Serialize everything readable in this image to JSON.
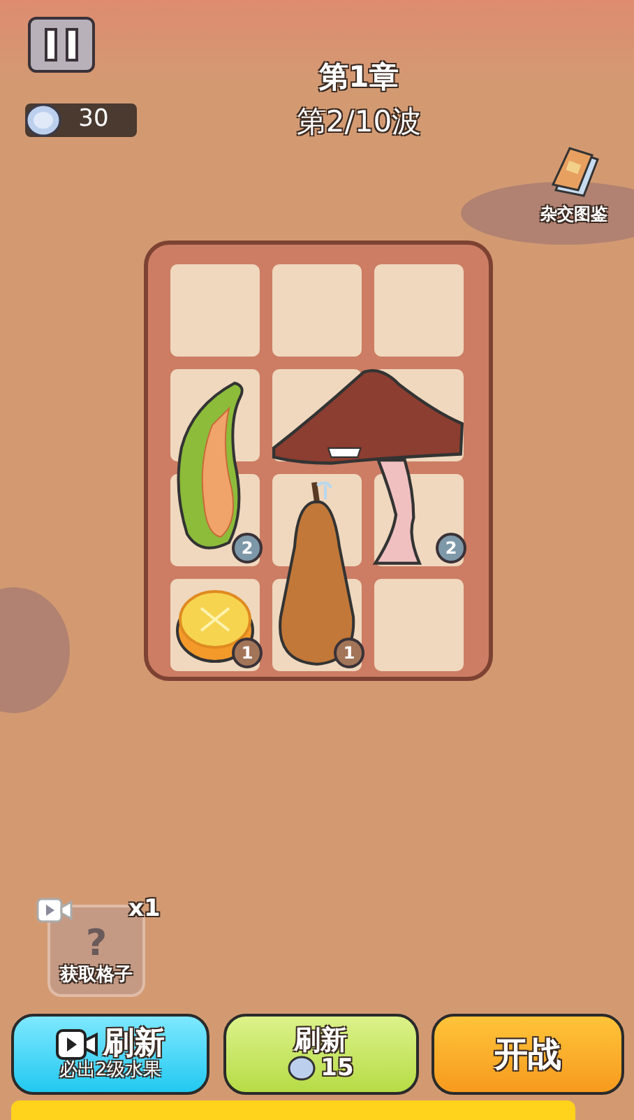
{
  "header": {
    "chapter": "第1章",
    "wave": "第2/10波",
    "coins": "30",
    "codex_label": "杂交图鉴"
  },
  "board": {
    "items": [
      {
        "kind": "melon",
        "level": "2"
      },
      {
        "kind": "mushroom",
        "level": "2"
      },
      {
        "kind": "lemon",
        "level": "1"
      },
      {
        "kind": "pear",
        "level": "1"
      }
    ]
  },
  "slot_offer": {
    "count": "x1",
    "symbol": "?",
    "label": "获取格子"
  },
  "buttons": [
    {
      "kind": "video",
      "title": "刷新",
      "subtitle": "必出2级水果"
    },
    {
      "kind": "coin",
      "title": "刷新",
      "price": "15"
    },
    {
      "kind": "plain",
      "title": "开战"
    }
  ]
}
